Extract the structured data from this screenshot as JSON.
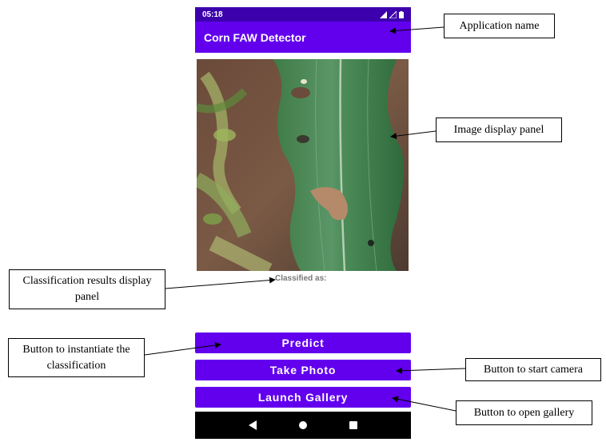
{
  "status_bar": {
    "time": "05:18"
  },
  "app_bar": {
    "title": "Corn FAW Detector"
  },
  "result": {
    "label": "Classified as:"
  },
  "buttons": {
    "predict": "Predict",
    "take_photo": "Take Photo",
    "launch_gallery": "Launch Gallery"
  },
  "annotations": {
    "app_name": "Application name",
    "image_panel": "Image display panel",
    "results_panel": "Classification results display panel",
    "classify_button": "Button to instantiate the classification",
    "camera_button": "Button to start camera",
    "gallery_button": "Button to open gallery"
  },
  "icons": [
    "signal-icon",
    "wifi-icon",
    "battery-icon",
    "back-icon",
    "home-icon",
    "recents-icon",
    "corn-leaf-image"
  ],
  "colors": {
    "primary": "#6200ee",
    "status_bar": "#3c00ad",
    "nav_bar": "#000000"
  }
}
